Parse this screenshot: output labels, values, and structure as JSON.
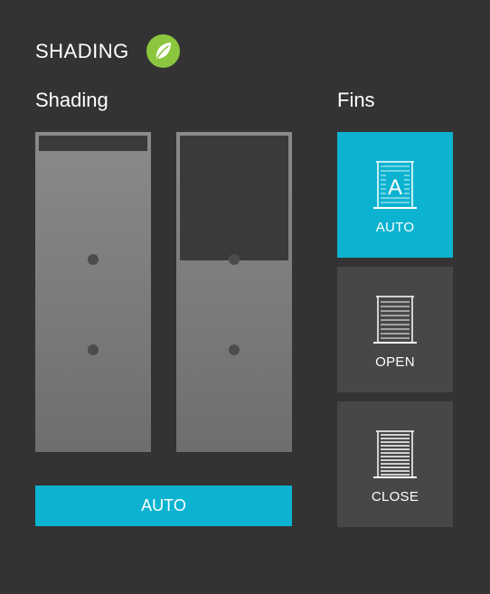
{
  "header": {
    "title": "SHADING",
    "badge_icon": "leaf-icon",
    "badge_color": "#8cc63f"
  },
  "shading": {
    "title": "Shading",
    "auto_button_label": "AUTO",
    "panels": [
      {
        "name": "left",
        "closed_fraction": 0.05
      },
      {
        "name": "right",
        "closed_fraction": 0.4
      }
    ]
  },
  "fins": {
    "title": "Fins",
    "accent_color": "#0cb3d0",
    "options": [
      {
        "label": "AUTO",
        "icon": "fins-auto-icon",
        "icon_letter": "A",
        "active": true
      },
      {
        "label": "OPEN",
        "icon": "fins-open-icon",
        "active": false
      },
      {
        "label": "CLOSE",
        "icon": "fins-close-icon",
        "active": false
      }
    ]
  }
}
